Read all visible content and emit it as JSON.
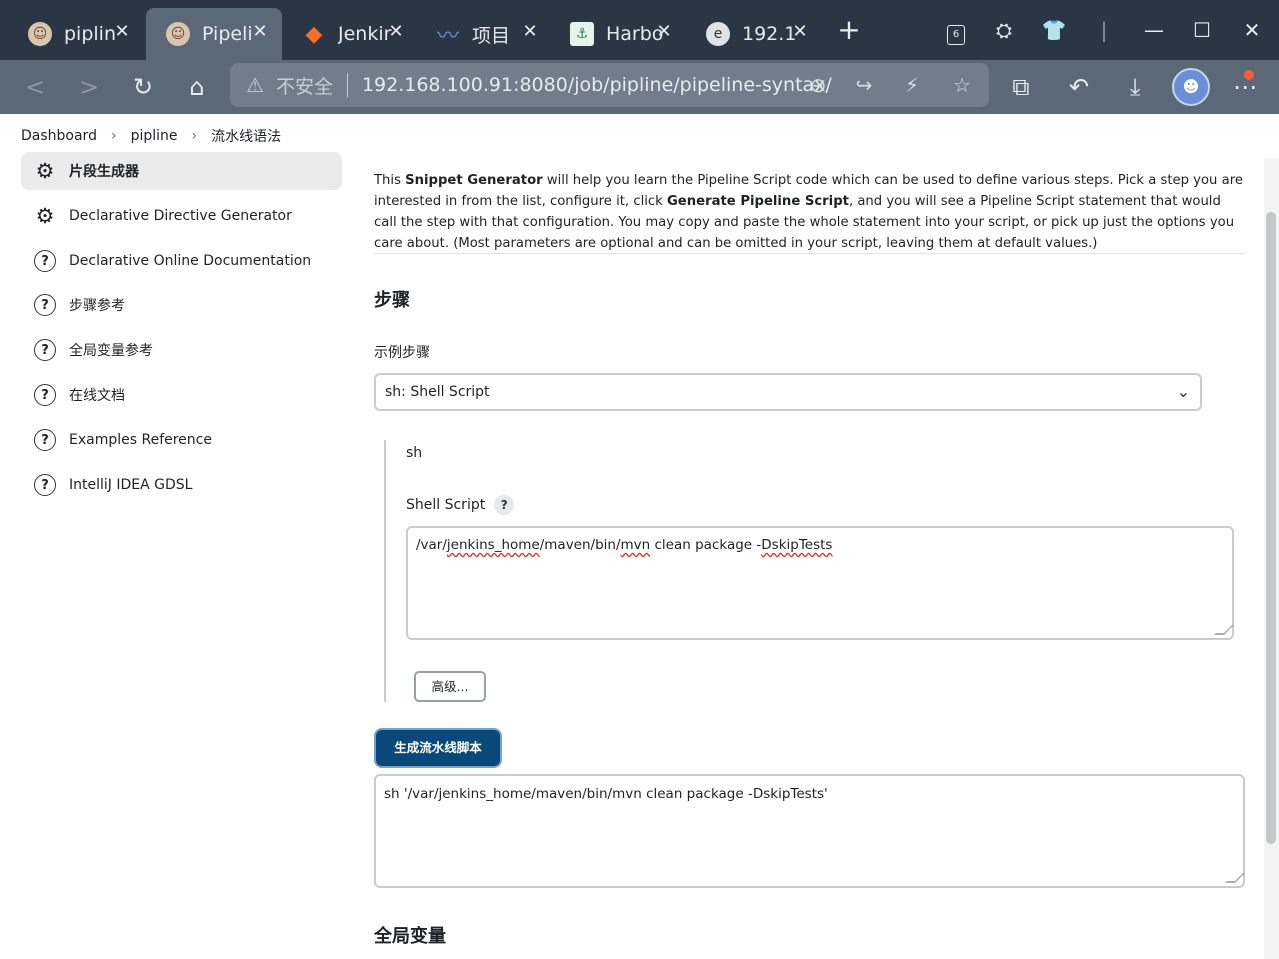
{
  "browser": {
    "tabs": [
      {
        "title": "piplin",
        "icon": "jenkins-icon",
        "active": false
      },
      {
        "title": "Pipeli",
        "icon": "jenkins-icon",
        "active": true
      },
      {
        "title": "Jenkir",
        "icon": "gitlab-icon",
        "active": false
      },
      {
        "title": "项目",
        "icon": "project-icon",
        "active": false
      },
      {
        "title": "Harbo",
        "icon": "harbor-icon",
        "active": false
      },
      {
        "title": "192.1",
        "icon": "edge-icon",
        "active": false
      }
    ],
    "tab_count_badge": "6",
    "address": {
      "security_text": "不安全",
      "url": "192.168.100.91:8080/job/pipline/pipeline-syntax/"
    }
  },
  "breadcrumb": [
    "Dashboard",
    "pipline",
    "流水线语法"
  ],
  "sidebar": {
    "items": [
      {
        "label": "片段生成器",
        "icon": "gear-icon",
        "active": true
      },
      {
        "label": "Declarative Directive Generator",
        "icon": "gear-icon",
        "active": false
      },
      {
        "label": "Declarative Online Documentation",
        "icon": "help-icon",
        "active": false
      },
      {
        "label": "步骤参考",
        "icon": "help-icon",
        "active": false
      },
      {
        "label": "全局变量参考",
        "icon": "help-icon",
        "active": false
      },
      {
        "label": "在线文档",
        "icon": "help-icon",
        "active": false
      },
      {
        "label": "Examples Reference",
        "icon": "help-icon",
        "active": false
      },
      {
        "label": "IntelliJ IDEA GDSL",
        "icon": "help-icon",
        "active": false
      }
    ]
  },
  "main": {
    "intro": {
      "p1": "This ",
      "b1": "Snippet Generator",
      "p2": " will help you learn the Pipeline Script code which can be used to define various steps. Pick a step you are interested in from the list, configure it, click ",
      "b2": "Generate Pipeline Script",
      "p3": ", and you will see a Pipeline Script statement that would call the step with that configuration. You may copy and paste the whole statement into your script, or pick up just the options you care about. (Most parameters are optional and can be omitted in your script, leaving them at default values.)"
    },
    "steps_heading": "步骤",
    "sample_step_label": "示例步骤",
    "sample_step_value": "sh: Shell Script",
    "step_name": "sh",
    "shell_script_label": "Shell Script",
    "help_glyph": "?",
    "shell_script_value": {
      "s1": "/var/",
      "w1": "jenkins_home",
      "s2": "/maven/bin/",
      "w2": "mvn",
      "s3": " clean package -",
      "w3": "DskipTests"
    },
    "advanced_button": "高级...",
    "generate_button": "生成流水线脚本",
    "generated_script": "sh '/var/jenkins_home/maven/bin/mvn clean package -DskipTests'",
    "global_vars_heading": "全局变量"
  },
  "colors": {
    "tab_bar": "#2b3644",
    "toolbar": "#5a6878",
    "primary_button": "#08497a"
  }
}
